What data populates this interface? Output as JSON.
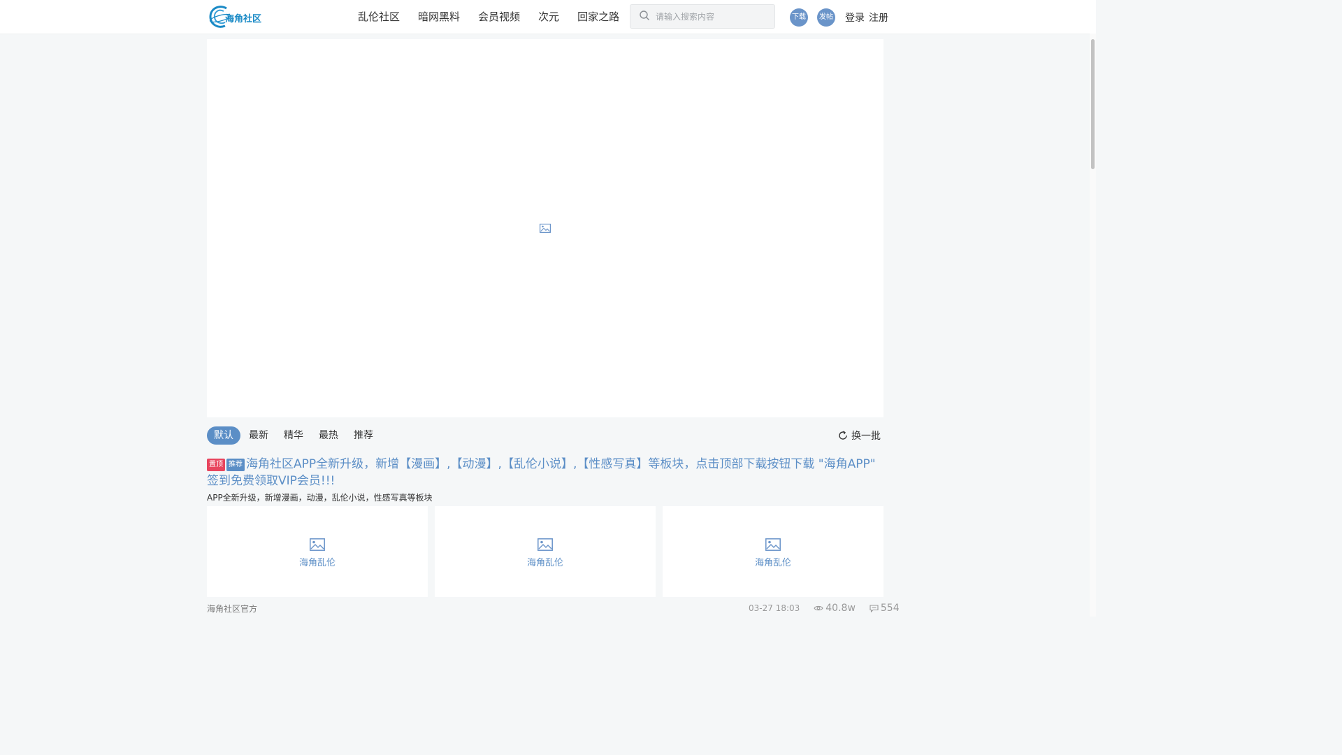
{
  "header": {
    "logo_text": "海角社区",
    "nav": [
      {
        "label": "乱伦社区"
      },
      {
        "label": "暗网黑料"
      },
      {
        "label": "会员视频"
      },
      {
        "label": "次元"
      },
      {
        "label": "回家之路"
      }
    ],
    "search_placeholder": "请输入搜索内容",
    "download_label": "下载",
    "post_label": "发帖",
    "login_label": "登录",
    "register_label": "注册"
  },
  "tabs": [
    {
      "label": "默认",
      "active": true
    },
    {
      "label": "最新"
    },
    {
      "label": "精华"
    },
    {
      "label": "最热"
    },
    {
      "label": "推荐"
    }
  ],
  "refresh_label": "换一批",
  "post": {
    "badge_pin": "置顶",
    "badge_recommend": "推荐",
    "title": "海角社区APP全新升级，新增【漫画】,【动漫】,【乱伦小说】,【性感写真】等板块，点击顶部下载按钮下载 \"海角APP\" 签到免费领取VIP会员!!!",
    "description": "APP全新升级，新增漫画，动漫，乱伦小说，性感写真等板块",
    "thumbnails": [
      {
        "label": "海角乱伦"
      },
      {
        "label": "海角乱伦"
      },
      {
        "label": "海角乱伦"
      }
    ],
    "author": "海角社区官方",
    "date": "03-27 18:03",
    "views": "40.8w",
    "comments": "554"
  },
  "colors": {
    "accent": "#5b8ec6",
    "pin_badge": "#e8455e",
    "logo": "#1a8ac6"
  },
  "icons": [
    "logo-icon",
    "search-icon",
    "image-icon",
    "refresh-icon",
    "eye-icon",
    "comment-icon"
  ]
}
